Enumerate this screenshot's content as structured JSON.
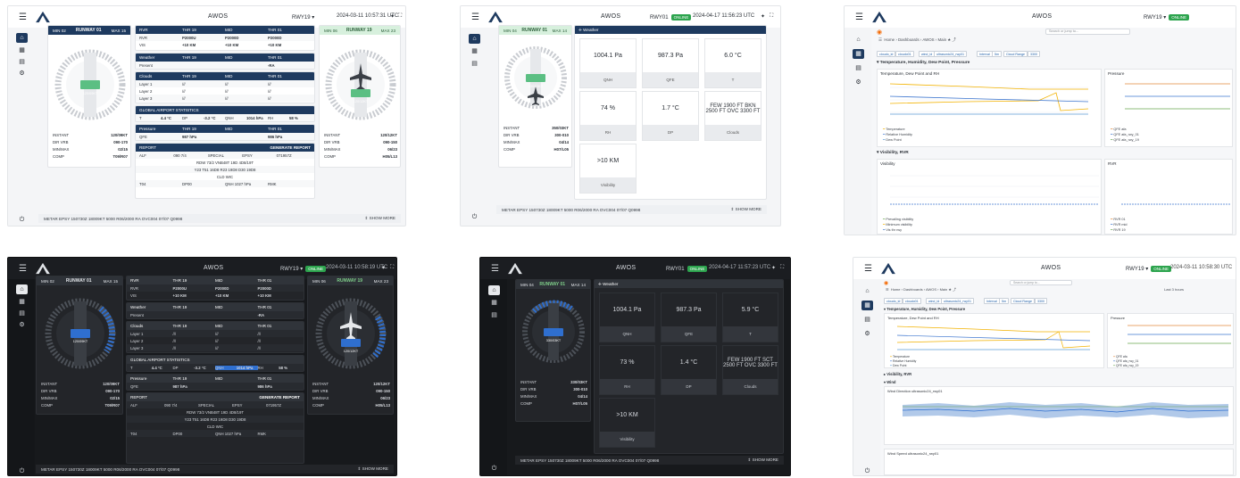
{
  "app_title": "AWOS",
  "runway": "RWY19",
  "runway_short": "RWY01",
  "online": "ONLINE",
  "clock1": "2024-03-11 10:57:31 UTC",
  "clock2": "2024-04-17 11:56:23 UTC",
  "clock3": "2024-03-11 10:58:19 UTC",
  "clock4": "2024-04-17 11:57:23 UTC",
  "clock5": "2024-03-11 10:58:30 UTC",
  "wind_left": {
    "min": "MIN 02",
    "rwy": "RUNWAY 01",
    "max": "MAX 15",
    "value": "120/09KT"
  },
  "wind_right": {
    "min": "MIN 06",
    "rwy": "RUNWAY 19",
    "max": "MAX 23",
    "value": "120/12KT"
  },
  "wind_tile": {
    "min": "MIN 04",
    "rwy": "RUNWAY 01",
    "max": "MAX 14",
    "value": "330/03KT"
  },
  "stats_left": [
    [
      "INSTANT",
      "120/09KT"
    ],
    [
      "DIR VRB",
      "090-170"
    ],
    [
      "MIN/MAX",
      "02/15"
    ],
    [
      "COMP",
      "T09/R07"
    ]
  ],
  "stats_right": [
    [
      "INSTANT",
      "120/12KT"
    ],
    [
      "DIR VRB",
      "090-150"
    ],
    [
      "MIN/MAX",
      "06/23"
    ],
    [
      "COMP",
      "H05/L13"
    ]
  ],
  "stats_tile": [
    [
      "INSTANT",
      "350/03KT"
    ],
    [
      "DIR VRB",
      "300-010"
    ],
    [
      "MIN/MAX",
      "04/14"
    ],
    [
      "COMP",
      "H07/L05"
    ]
  ],
  "stats_tile_dark": [
    [
      "INSTANT",
      "330/03KT"
    ],
    [
      "DIR VRB",
      "300-010"
    ],
    [
      "MIN/MAX",
      "04/14"
    ],
    [
      "COMP",
      "H07/L05"
    ]
  ],
  "rvr": {
    "title": "RVR",
    "cols": [
      "THR 19",
      "MID",
      "THR 01"
    ],
    "rows": [
      [
        "RVR",
        "P2000U",
        "P2000D",
        "P2000D"
      ],
      [
        "VIS",
        "+10 KM",
        "+10 KM",
        "+10 KM"
      ]
    ]
  },
  "weather": {
    "title": "Weather",
    "cols": [
      "THR 19",
      "MID",
      "THR 01"
    ],
    "rows": [
      [
        "Present",
        "",
        "",
        "-RA"
      ]
    ]
  },
  "clouds": {
    "title": "Clouds",
    "cols": [
      "THR 19",
      "MID",
      "THR 01"
    ],
    "rows": [
      [
        "Layer 1",
        "///",
        "///",
        "///"
      ],
      [
        "Layer 2",
        "///",
        "///",
        "///"
      ],
      [
        "Layer 3",
        "///",
        "///",
        "///"
      ]
    ]
  },
  "global": {
    "title": "GLOBAL AIRPORT STATISTICS",
    "items": [
      "T",
      "4.4 °C",
      "DP",
      "-3.2 °C",
      "QNH",
      "1014 hPa",
      "RH",
      "58 %"
    ]
  },
  "global_dark": {
    "items": [
      "T",
      "4.4 °C",
      "DP",
      "-3.2 °C",
      "QNH",
      "1014 hPa",
      "RH",
      "58 %"
    ]
  },
  "pressure": {
    "title": "Pressure",
    "cols": [
      "THR 19",
      "MID",
      "THR 01"
    ],
    "rows": [
      [
        "QFE",
        "987 hPa",
        "",
        "986 hPa"
      ]
    ]
  },
  "report": {
    "title": "REPORT",
    "action": "GENERATE REPORT",
    "line1": [
      "ALF",
      "090 7/4",
      "SPECIAL",
      "EPSY",
      "071957Z"
    ],
    "line2": "RDW 73/2 VNB48T 19D 4D8/19T",
    "line3": "Y23 T51 16D8 R23 19D8 D30 19D8",
    "line4": "CLD WIC",
    "line5": [
      "T04",
      "DP00",
      "QNH 1027 hPa",
      "RMK"
    ]
  },
  "metar": "METAR EPSY 150730Z 18009KT 5000 R06/2000 RA OVC004 07/07 Q0998",
  "metar2": "METAR EPSY 150730Z 18009KT 5000 R06/2000 RA OVC004 07/07 Q0998",
  "show_more": "SHOW MORE",
  "weather_tile": {
    "header": "Weather",
    "items": [
      [
        "1004.1 Pa",
        "QNH"
      ],
      [
        "987.3 Pa",
        "QFE"
      ],
      [
        "6.0 °C",
        "T"
      ],
      [
        "74 %",
        "RH"
      ],
      [
        "1.7 °C",
        "DP"
      ],
      [
        "FEW 1900 FT BKN 2500 FT OVC 3300 FT",
        "Clouds"
      ],
      [
        ">10 KM",
        "Visibility"
      ]
    ]
  },
  "weather_tile_dark": {
    "header": "Weather",
    "items": [
      [
        "1004.1 Pa",
        "QNH"
      ],
      [
        "987.3 Pa",
        "QFE"
      ],
      [
        "5.9 °C",
        "T"
      ],
      [
        "73 %",
        "RH"
      ],
      [
        "1.4 °C",
        "DP"
      ],
      [
        "FEW 1900 FT SCT 2500 FT OVC 3300 FT",
        "Clouds"
      ],
      [
        ">10 KM",
        "Visibility"
      ]
    ]
  },
  "grafana": {
    "breadcrumb": "Home › Dashboards › AWOS › Main",
    "search": "Search or jump to...",
    "chips": [
      "cloudo_id",
      "cloudo01",
      "wind_id",
      "ultrasonic24_rwy01",
      "Interval",
      "5m",
      "Cloud Range",
      "3300"
    ],
    "sec1": "Temperature, Humidity, Dew Point, Pressure",
    "p1": "Temperature, Dew Point and RH",
    "p2": "Pressure",
    "sec2": "Visibility, RVR",
    "p3": "Visibility",
    "p4": "RVR",
    "sec3": "Wind",
    "p5": "Wind Direction ultrasonic24_rwy01",
    "p6": "Wind Speed ultrasonic24_rwy01",
    "legend1": [
      "Temperature",
      "Relative Humidity",
      "Dew Point"
    ],
    "legend2": [
      "QFE afa",
      "QFE afa_rwy_01",
      "QFE afa_rwy_19"
    ],
    "legend3": [
      "Prevailing visibility",
      "Minimum visibility",
      "Vis thr rwy",
      "Vis thr mid"
    ],
    "legend4": [
      "RVR 01",
      "RVR mid",
      "RVR 19"
    ],
    "last": "Last 3 hours"
  },
  "colors": {
    "brand": "#1e3a5f",
    "online": "#2da44e",
    "arc": "#2f6fcf",
    "temp": "#f2b200",
    "rh": "#3d76cf",
    "dp": "#5b9bd5"
  }
}
